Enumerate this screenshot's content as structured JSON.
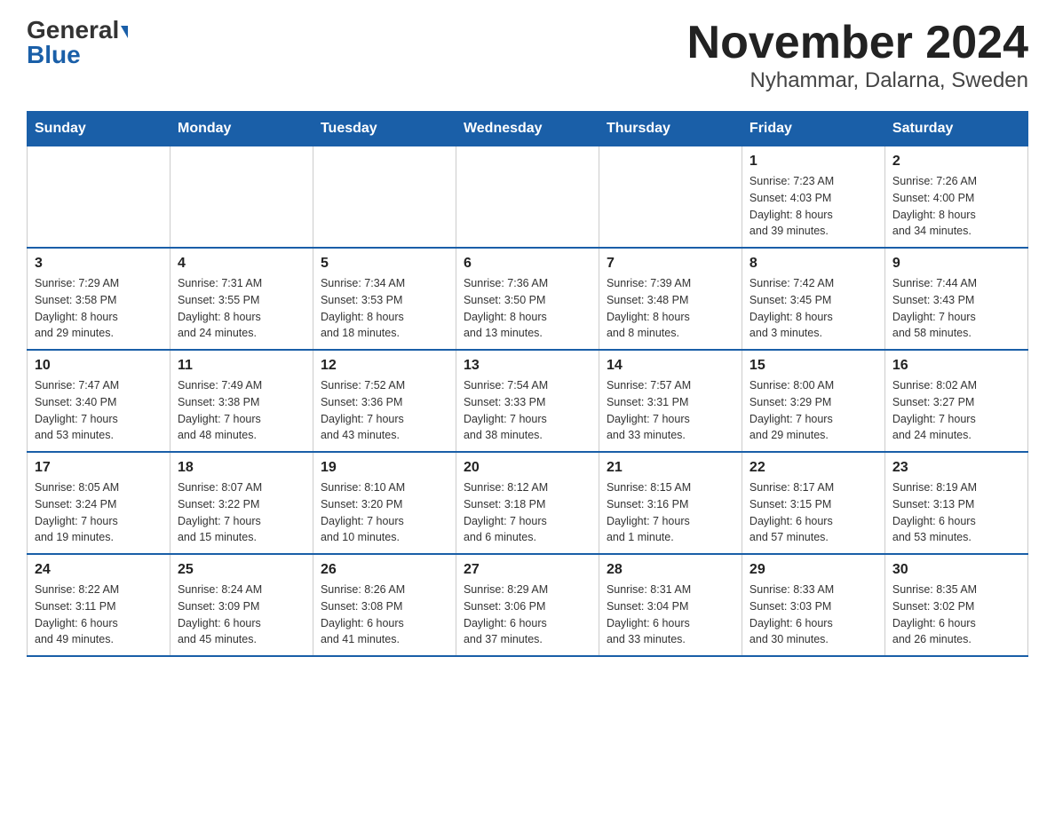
{
  "header": {
    "logo_general": "General",
    "logo_blue": "Blue",
    "title": "November 2024",
    "subtitle": "Nyhammar, Dalarna, Sweden"
  },
  "calendar": {
    "weekdays": [
      "Sunday",
      "Monday",
      "Tuesday",
      "Wednesday",
      "Thursday",
      "Friday",
      "Saturday"
    ],
    "weeks": [
      [
        {
          "day": "",
          "info": ""
        },
        {
          "day": "",
          "info": ""
        },
        {
          "day": "",
          "info": ""
        },
        {
          "day": "",
          "info": ""
        },
        {
          "day": "",
          "info": ""
        },
        {
          "day": "1",
          "info": "Sunrise: 7:23 AM\nSunset: 4:03 PM\nDaylight: 8 hours\nand 39 minutes."
        },
        {
          "day": "2",
          "info": "Sunrise: 7:26 AM\nSunset: 4:00 PM\nDaylight: 8 hours\nand 34 minutes."
        }
      ],
      [
        {
          "day": "3",
          "info": "Sunrise: 7:29 AM\nSunset: 3:58 PM\nDaylight: 8 hours\nand 29 minutes."
        },
        {
          "day": "4",
          "info": "Sunrise: 7:31 AM\nSunset: 3:55 PM\nDaylight: 8 hours\nand 24 minutes."
        },
        {
          "day": "5",
          "info": "Sunrise: 7:34 AM\nSunset: 3:53 PM\nDaylight: 8 hours\nand 18 minutes."
        },
        {
          "day": "6",
          "info": "Sunrise: 7:36 AM\nSunset: 3:50 PM\nDaylight: 8 hours\nand 13 minutes."
        },
        {
          "day": "7",
          "info": "Sunrise: 7:39 AM\nSunset: 3:48 PM\nDaylight: 8 hours\nand 8 minutes."
        },
        {
          "day": "8",
          "info": "Sunrise: 7:42 AM\nSunset: 3:45 PM\nDaylight: 8 hours\nand 3 minutes."
        },
        {
          "day": "9",
          "info": "Sunrise: 7:44 AM\nSunset: 3:43 PM\nDaylight: 7 hours\nand 58 minutes."
        }
      ],
      [
        {
          "day": "10",
          "info": "Sunrise: 7:47 AM\nSunset: 3:40 PM\nDaylight: 7 hours\nand 53 minutes."
        },
        {
          "day": "11",
          "info": "Sunrise: 7:49 AM\nSunset: 3:38 PM\nDaylight: 7 hours\nand 48 minutes."
        },
        {
          "day": "12",
          "info": "Sunrise: 7:52 AM\nSunset: 3:36 PM\nDaylight: 7 hours\nand 43 minutes."
        },
        {
          "day": "13",
          "info": "Sunrise: 7:54 AM\nSunset: 3:33 PM\nDaylight: 7 hours\nand 38 minutes."
        },
        {
          "day": "14",
          "info": "Sunrise: 7:57 AM\nSunset: 3:31 PM\nDaylight: 7 hours\nand 33 minutes."
        },
        {
          "day": "15",
          "info": "Sunrise: 8:00 AM\nSunset: 3:29 PM\nDaylight: 7 hours\nand 29 minutes."
        },
        {
          "day": "16",
          "info": "Sunrise: 8:02 AM\nSunset: 3:27 PM\nDaylight: 7 hours\nand 24 minutes."
        }
      ],
      [
        {
          "day": "17",
          "info": "Sunrise: 8:05 AM\nSunset: 3:24 PM\nDaylight: 7 hours\nand 19 minutes."
        },
        {
          "day": "18",
          "info": "Sunrise: 8:07 AM\nSunset: 3:22 PM\nDaylight: 7 hours\nand 15 minutes."
        },
        {
          "day": "19",
          "info": "Sunrise: 8:10 AM\nSunset: 3:20 PM\nDaylight: 7 hours\nand 10 minutes."
        },
        {
          "day": "20",
          "info": "Sunrise: 8:12 AM\nSunset: 3:18 PM\nDaylight: 7 hours\nand 6 minutes."
        },
        {
          "day": "21",
          "info": "Sunrise: 8:15 AM\nSunset: 3:16 PM\nDaylight: 7 hours\nand 1 minute."
        },
        {
          "day": "22",
          "info": "Sunrise: 8:17 AM\nSunset: 3:15 PM\nDaylight: 6 hours\nand 57 minutes."
        },
        {
          "day": "23",
          "info": "Sunrise: 8:19 AM\nSunset: 3:13 PM\nDaylight: 6 hours\nand 53 minutes."
        }
      ],
      [
        {
          "day": "24",
          "info": "Sunrise: 8:22 AM\nSunset: 3:11 PM\nDaylight: 6 hours\nand 49 minutes."
        },
        {
          "day": "25",
          "info": "Sunrise: 8:24 AM\nSunset: 3:09 PM\nDaylight: 6 hours\nand 45 minutes."
        },
        {
          "day": "26",
          "info": "Sunrise: 8:26 AM\nSunset: 3:08 PM\nDaylight: 6 hours\nand 41 minutes."
        },
        {
          "day": "27",
          "info": "Sunrise: 8:29 AM\nSunset: 3:06 PM\nDaylight: 6 hours\nand 37 minutes."
        },
        {
          "day": "28",
          "info": "Sunrise: 8:31 AM\nSunset: 3:04 PM\nDaylight: 6 hours\nand 33 minutes."
        },
        {
          "day": "29",
          "info": "Sunrise: 8:33 AM\nSunset: 3:03 PM\nDaylight: 6 hours\nand 30 minutes."
        },
        {
          "day": "30",
          "info": "Sunrise: 8:35 AM\nSunset: 3:02 PM\nDaylight: 6 hours\nand 26 minutes."
        }
      ]
    ]
  }
}
